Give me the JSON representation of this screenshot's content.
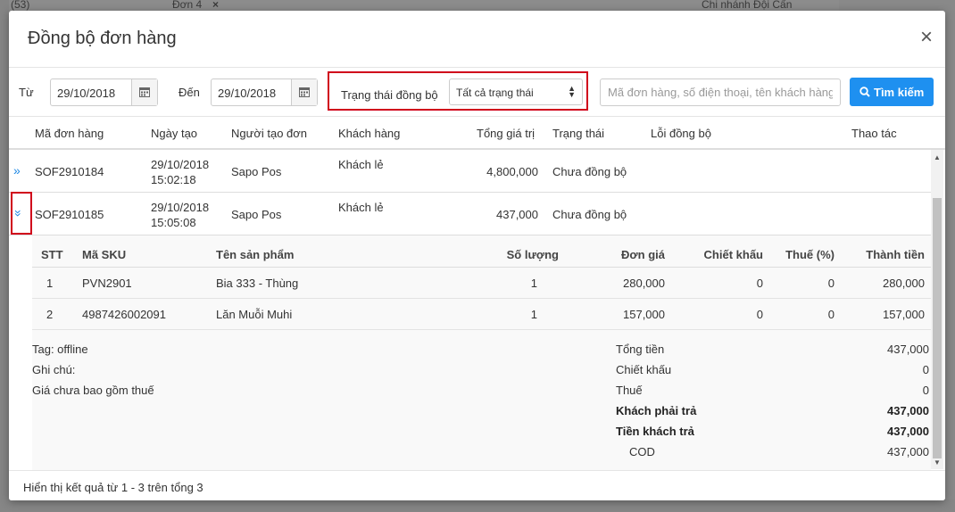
{
  "background": {
    "top_items": [
      "(53)",
      "Đơn 4",
      "×",
      "Chi nhánh Đội Cấn"
    ]
  },
  "modal": {
    "title": "Đồng bộ đơn hàng",
    "close_icon": "close-icon"
  },
  "filters": {
    "from_label": "Từ",
    "from_value": "29/10/2018",
    "to_label": "Đến",
    "to_value": "29/10/2018",
    "status_label": "Trạng thái đồng bộ",
    "status_value": "Tất cả trạng thái",
    "search_placeholder": "Mã đơn hàng, số điện thoại, tên khách hàng",
    "search_button": "Tìm kiếm"
  },
  "columns": [
    "Mã đơn hàng",
    "Ngày tạo",
    "Người tạo đơn",
    "Khách hàng",
    "Tổng giá trị",
    "Trạng thái",
    "Lỗi đồng bộ",
    "Thao tác"
  ],
  "orders": [
    {
      "code": "SOF2910184",
      "date": "29/10/2018",
      "time": "15:02:18",
      "creator": "Sapo Pos",
      "customer": "Khách lẻ",
      "total": "4,800,000",
      "status": "Chưa đồng bộ",
      "expander": "»"
    },
    {
      "code": "SOF2910185",
      "date": "29/10/2018",
      "time": "15:05:08",
      "creator": "Sapo Pos",
      "customer": "Khách lẻ",
      "total": "437,000",
      "status": "Chưa đồng bộ",
      "expander": "»"
    }
  ],
  "detail": {
    "columns": [
      "STT",
      "Mã SKU",
      "Tên sản phẩm",
      "Số lượng",
      "Đơn giá",
      "Chiết khấu",
      "Thuế (%)",
      "Thành tiền"
    ],
    "items": [
      {
        "stt": "1",
        "sku": "PVN2901",
        "name": "Bia 333 - Thùng",
        "qty": "1",
        "price": "280,000",
        "discount": "0",
        "tax": "0",
        "amount": "280,000"
      },
      {
        "stt": "2",
        "sku": "4987426002091",
        "name": "Lăn Muỗi Muhi",
        "qty": "1",
        "price": "157,000",
        "discount": "0",
        "tax": "0",
        "amount": "157,000"
      }
    ],
    "notes": {
      "tag": "Tag: offline",
      "note": "Ghi chú:",
      "tax_note": "Giá chưa bao gồm thuế"
    },
    "summary": {
      "total_label": "Tổng tiền",
      "total_value": "437,000",
      "discount_label": "Chiết khấu",
      "discount_value": "0",
      "tax_label": "Thuế",
      "tax_value": "0",
      "payable_label": "Khách phải trả",
      "payable_value": "437,000",
      "paid_label": "Tiền khách trả",
      "paid_value": "437,000",
      "cod_label": "COD",
      "cod_value": "437,000"
    }
  },
  "footer": {
    "text": "Hiển thị kết quả từ 1 - 3 trên tổng 3"
  },
  "colors": {
    "primary": "#1e90f0",
    "highlight": "#d0021b"
  }
}
